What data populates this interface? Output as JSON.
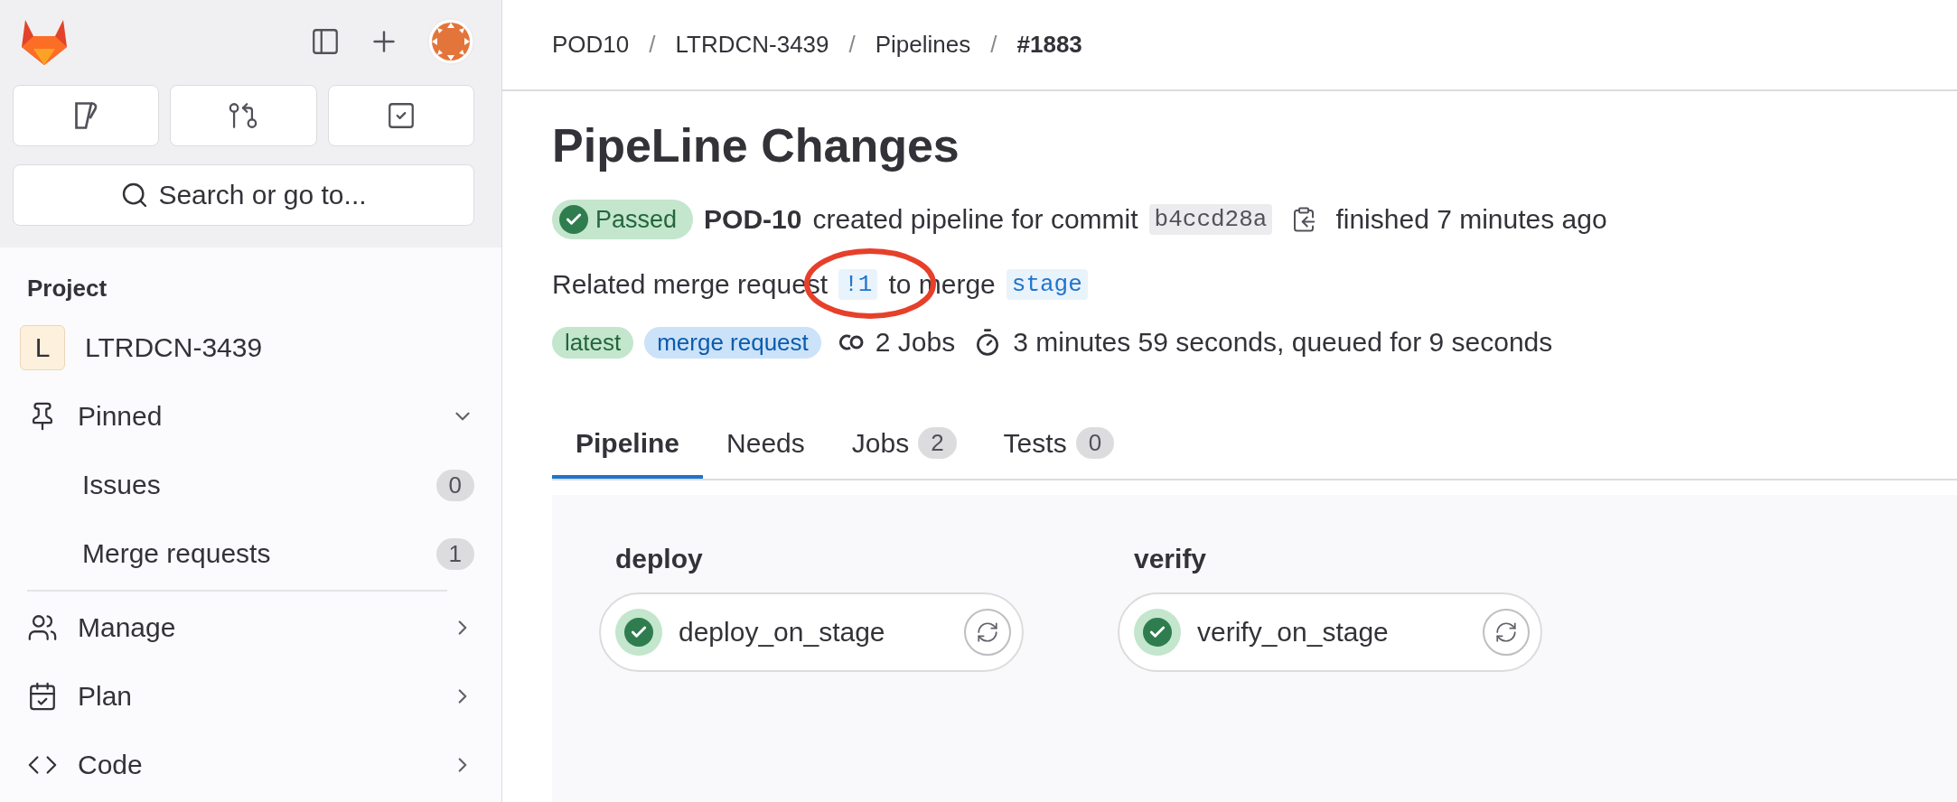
{
  "sidebar": {
    "search": {
      "placeholder": "Search or go to..."
    },
    "section_title": "Project",
    "project": {
      "avatar": "L",
      "name": "LTRDCN-3439"
    },
    "items": [
      {
        "kind": "group",
        "label": "Pinned",
        "expanded": true,
        "children": [
          {
            "label": "Issues",
            "count": "0"
          },
          {
            "label": "Merge requests",
            "count": "1"
          }
        ]
      },
      {
        "kind": "group",
        "label": "Manage",
        "expanded": false
      },
      {
        "kind": "group",
        "label": "Plan",
        "expanded": false
      },
      {
        "kind": "group",
        "label": "Code",
        "expanded": false
      }
    ]
  },
  "breadcrumb": [
    {
      "kind": "link",
      "text": "POD10"
    },
    {
      "kind": "separator",
      "text": "/"
    },
    {
      "kind": "link",
      "text": "LTRDCN-3439"
    },
    {
      "kind": "separator",
      "text": "/"
    },
    {
      "kind": "link",
      "text": "Pipelines"
    },
    {
      "kind": "separator",
      "text": "/"
    },
    {
      "kind": "current",
      "text": "#1883"
    }
  ],
  "title": "PipeLine Changes",
  "status_line": {
    "status_label": "Passed",
    "author": "POD-10",
    "action": "created pipeline for commit",
    "commit": "b4ccd28a",
    "finished": "finished 7 minutes ago"
  },
  "related": {
    "prefix": "Related merge request",
    "merge_request": "!1",
    "middle": "to merge",
    "branch": "stage"
  },
  "meta": {
    "tags": [
      {
        "label": "latest",
        "kind": "success"
      },
      {
        "label": "merge request",
        "kind": "info"
      }
    ],
    "jobs": "2 Jobs",
    "duration": "3 minutes 59 seconds, queued for 9 seconds"
  },
  "tabs": [
    {
      "label": "Pipeline",
      "selected": true
    },
    {
      "label": "Needs",
      "selected": false
    },
    {
      "label": "Jobs",
      "count": "2",
      "selected": false
    },
    {
      "label": "Tests",
      "count": "0",
      "selected": false
    }
  ],
  "stages": [
    {
      "name": "deploy",
      "jobs": [
        {
          "name": "deploy_on_stage"
        }
      ]
    },
    {
      "name": "verify",
      "jobs": [
        {
          "name": "verify_on_stage"
        }
      ]
    }
  ]
}
